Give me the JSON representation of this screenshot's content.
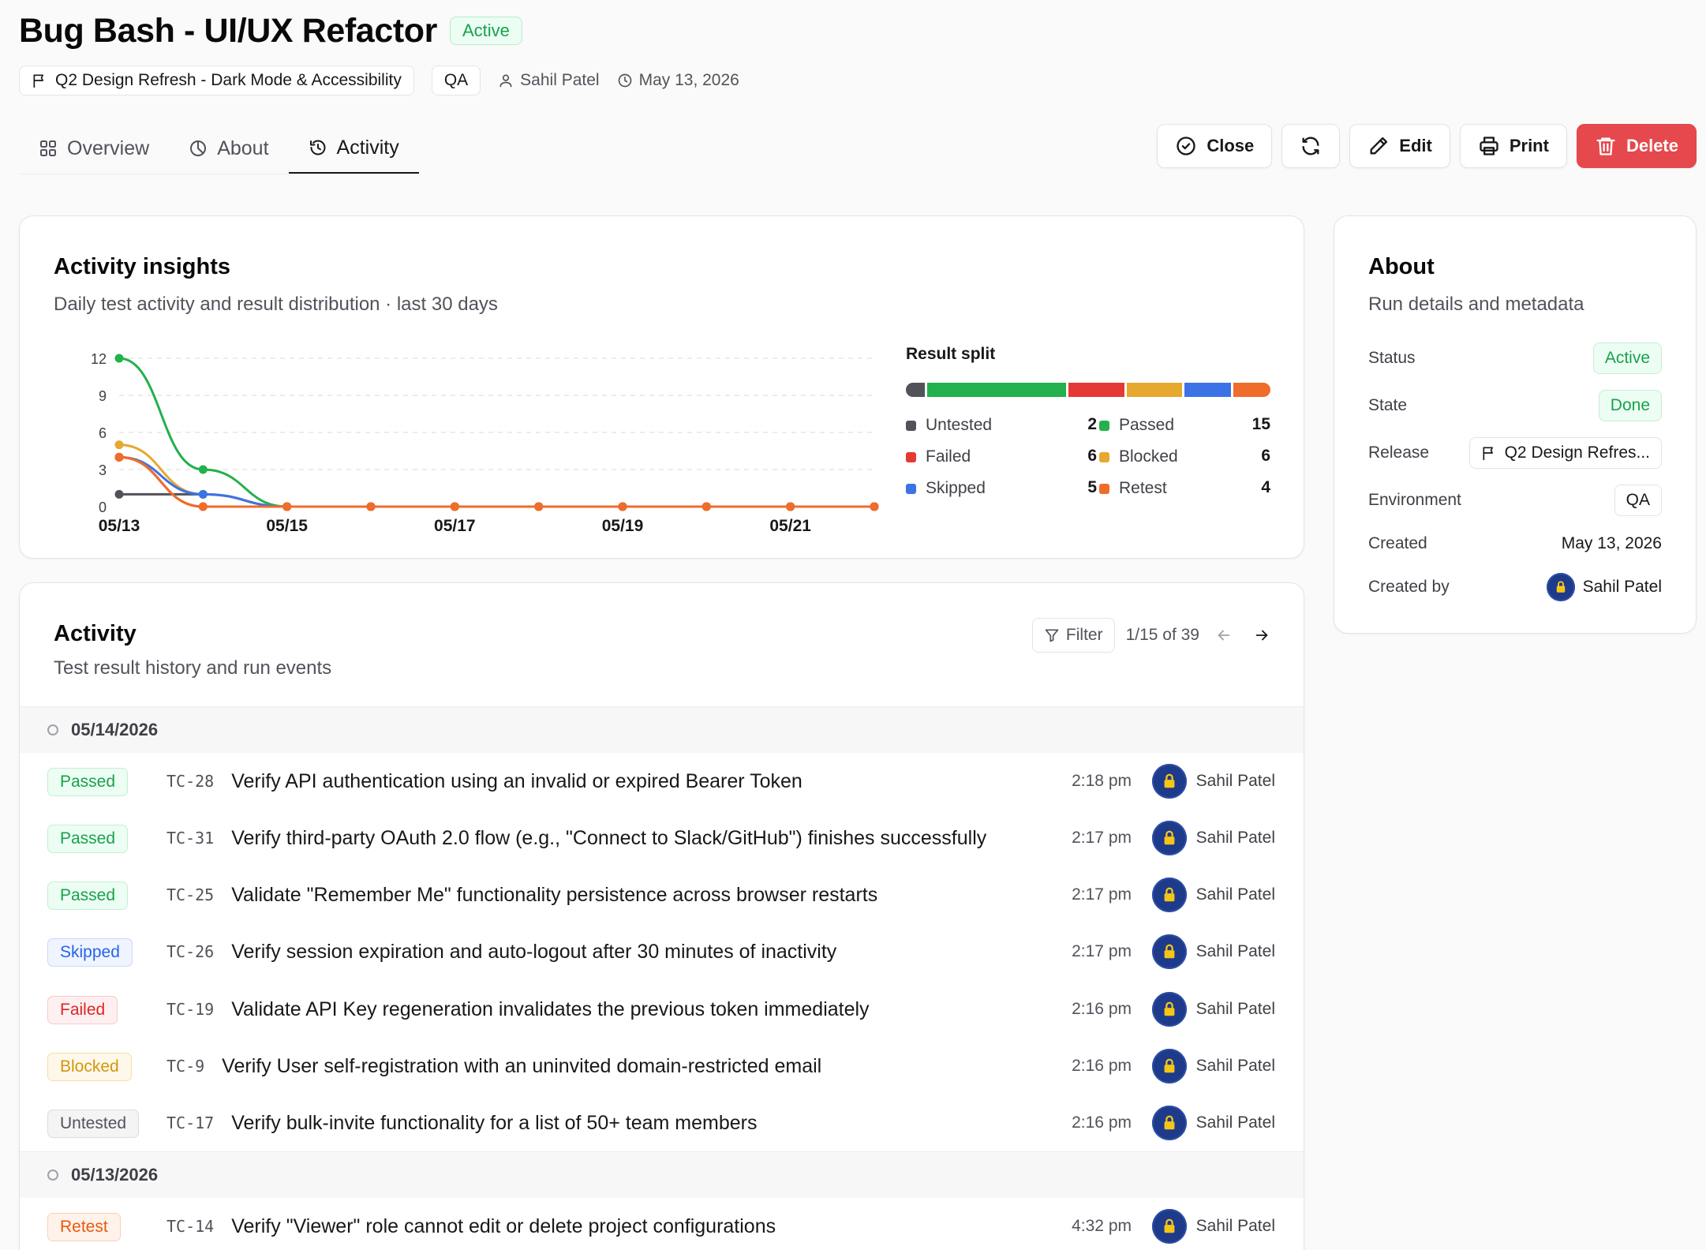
{
  "header": {
    "title": "Bug Bash - UI/UX Refactor",
    "status": "Active",
    "release_chip": "Q2 Design Refresh - Dark Mode & Accessibility",
    "env_chip": "QA",
    "owner": "Sahil Patel",
    "date": "May 13, 2026"
  },
  "tabs": [
    {
      "label": "Overview",
      "icon": "grid-icon"
    },
    {
      "label": "About",
      "icon": "pie-chart-icon"
    },
    {
      "label": "Activity",
      "icon": "history-icon",
      "active": true
    }
  ],
  "actions": {
    "close": "Close",
    "edit": "Edit",
    "print": "Print",
    "delete": "Delete"
  },
  "insights": {
    "title": "Activity insights",
    "subtitle": "Daily test activity and result distribution · last 30 days",
    "split_title": "Result split",
    "legend": [
      {
        "label": "Untested",
        "count": "2",
        "color": "#52525b"
      },
      {
        "label": "Passed",
        "count": "15",
        "color": "#22b14c"
      },
      {
        "label": "Failed",
        "count": "6",
        "color": "#e53935"
      },
      {
        "label": "Blocked",
        "count": "6",
        "color": "#e6a82e"
      },
      {
        "label": "Skipped",
        "count": "5",
        "color": "#3b73e6"
      },
      {
        "label": "Retest",
        "count": "4",
        "color": "#ef6c2a"
      }
    ]
  },
  "chart_data": {
    "type": "line",
    "x": [
      "05/13",
      "05/14",
      "05/15",
      "05/16",
      "05/17",
      "05/18",
      "05/19",
      "05/20",
      "05/21",
      "05/22"
    ],
    "x_tick_labels": [
      "05/13",
      "05/15",
      "05/17",
      "05/19",
      "05/21"
    ],
    "y_ticks": [
      0,
      3,
      6,
      9,
      12
    ],
    "ylim": [
      0,
      12
    ],
    "grid": true,
    "series": [
      {
        "name": "Untested",
        "color": "#52525b",
        "values": [
          1,
          1,
          0,
          0,
          0,
          0,
          0,
          0,
          0,
          0
        ]
      },
      {
        "name": "Passed",
        "color": "#22b14c",
        "values": [
          12,
          3,
          0,
          0,
          0,
          0,
          0,
          0,
          0,
          0
        ]
      },
      {
        "name": "Blocked",
        "color": "#e6a82e",
        "values": [
          5,
          1,
          0,
          0,
          0,
          0,
          0,
          0,
          0,
          0
        ]
      },
      {
        "name": "Skipped",
        "color": "#3b73e6",
        "values": [
          4,
          1,
          0,
          0,
          0,
          0,
          0,
          0,
          0,
          0
        ]
      },
      {
        "name": "Failed",
        "color": "#e53935",
        "values": [
          4,
          0,
          0,
          0,
          0,
          0,
          0,
          0,
          0,
          0
        ]
      },
      {
        "name": "Retest",
        "color": "#ef6c2a",
        "values": [
          4,
          0,
          0,
          0,
          0,
          0,
          0,
          0,
          0,
          0
        ]
      }
    ]
  },
  "about": {
    "title": "About",
    "subtitle": "Run details and metadata",
    "rows": [
      {
        "label": "Status",
        "value": "Active"
      },
      {
        "label": "State",
        "value": "Done"
      },
      {
        "label": "Release",
        "value": "Q2 Design Refres..."
      },
      {
        "label": "Environment",
        "value": "QA"
      },
      {
        "label": "Created",
        "value": "May 13, 2026"
      },
      {
        "label": "Created by",
        "value": "Sahil Patel"
      }
    ]
  },
  "activity": {
    "title": "Activity",
    "subtitle": "Test result history and run events",
    "filter_label": "Filter",
    "pager": "1/15 of 39",
    "groups": [
      {
        "date": "05/14/2026",
        "items": [
          {
            "status": "Passed",
            "id": "TC-28",
            "title": "Verify API authentication using an invalid or expired Bearer Token",
            "time": "2:18 pm",
            "user": "Sahil Patel"
          },
          {
            "status": "Passed",
            "id": "TC-31",
            "title": "Verify third-party OAuth 2.0 flow (e.g., \"Connect to Slack/GitHub\") finishes successfully",
            "time": "2:17 pm",
            "user": "Sahil Patel"
          },
          {
            "status": "Passed",
            "id": "TC-25",
            "title": "Validate \"Remember Me\" functionality persistence across browser restarts",
            "time": "2:17 pm",
            "user": "Sahil Patel"
          },
          {
            "status": "Skipped",
            "id": "TC-26",
            "title": "Verify session expiration and auto-logout after 30 minutes of inactivity",
            "time": "2:17 pm",
            "user": "Sahil Patel"
          },
          {
            "status": "Failed",
            "id": "TC-19",
            "title": "Validate API Key regeneration invalidates the previous token immediately",
            "time": "2:16 pm",
            "user": "Sahil Patel"
          },
          {
            "status": "Blocked",
            "id": "TC-9",
            "title": "Verify User self-registration with an uninvited domain-restricted email",
            "time": "2:16 pm",
            "user": "Sahil Patel"
          },
          {
            "status": "Untested",
            "id": "TC-17",
            "title": "Verify bulk-invite functionality for a list of 50+ team members",
            "time": "2:16 pm",
            "user": "Sahil Patel"
          }
        ]
      },
      {
        "date": "05/13/2026",
        "items": [
          {
            "status": "Retest",
            "id": "TC-14",
            "title": "Verify \"Viewer\" role cannot edit or delete project configurations",
            "time": "4:32 pm",
            "user": "Sahil Patel"
          }
        ]
      }
    ]
  }
}
